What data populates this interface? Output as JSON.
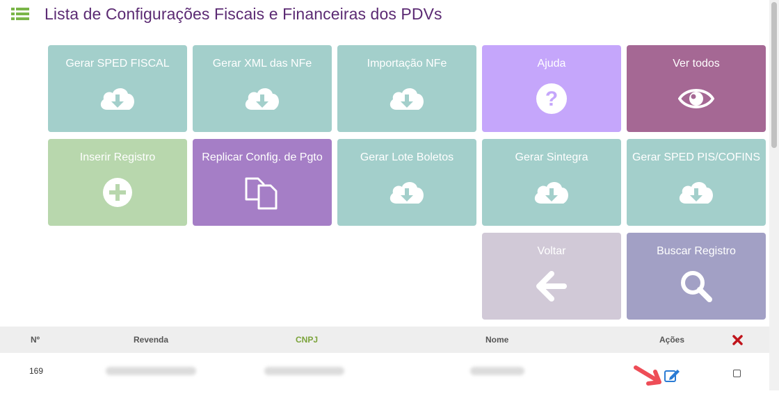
{
  "page": {
    "title": "Lista de Configurações Fiscais e Financeiras dos PDVs",
    "icon": "list-icon"
  },
  "tiles": [
    {
      "label": "Gerar SPED FISCAL",
      "icon": "cloud-download-icon",
      "color": "#a3cfcb"
    },
    {
      "label": "Gerar XML das NFe",
      "icon": "cloud-download-icon",
      "color": "#a3cfcb"
    },
    {
      "label": "Importação NFe",
      "icon": "cloud-download-icon",
      "color": "#a3cfcb"
    },
    {
      "label": "Ajuda",
      "icon": "question-circle-icon",
      "color": "#c5a6fb"
    },
    {
      "label": "Ver todos",
      "icon": "eye-icon",
      "color": "#a56894"
    },
    {
      "label": "Inserir Registro",
      "icon": "plus-circle-icon",
      "color": "#b8d7ad"
    },
    {
      "label": "Replicar Config. de Pgto",
      "icon": "copy-icon",
      "color": "#a57ec6"
    },
    {
      "label": "Gerar Lote Boletos",
      "icon": "cloud-download-icon",
      "color": "#a3cfcb"
    },
    {
      "label": "Gerar Sintegra",
      "icon": "cloud-download-icon",
      "color": "#a3cfcb"
    },
    {
      "label": "Gerar SPED PIS/COFINS",
      "icon": "cloud-download-icon",
      "color": "#a3cfcb"
    },
    {
      "label": "Voltar",
      "icon": "arrow-left-icon",
      "color": "#d1c9d7"
    },
    {
      "label": "Buscar Registro",
      "icon": "search-icon",
      "color": "#a2a0c5"
    }
  ],
  "table": {
    "headers": {
      "numero": "Nº",
      "revenda": "Revenda",
      "cnpj": "CNPJ",
      "nome": "Nome",
      "acoes": "Ações",
      "delete_icon": "close-icon"
    },
    "colors": {
      "cnpj_header": "#7ba33a",
      "delete": "#c0141b",
      "edit": "#2a7bd4",
      "arrow": "#ee4d57"
    },
    "rows": [
      {
        "numero": "169",
        "edit_icon": "edit-icon",
        "annotation_icon": "red-arrow-icon"
      }
    ]
  }
}
